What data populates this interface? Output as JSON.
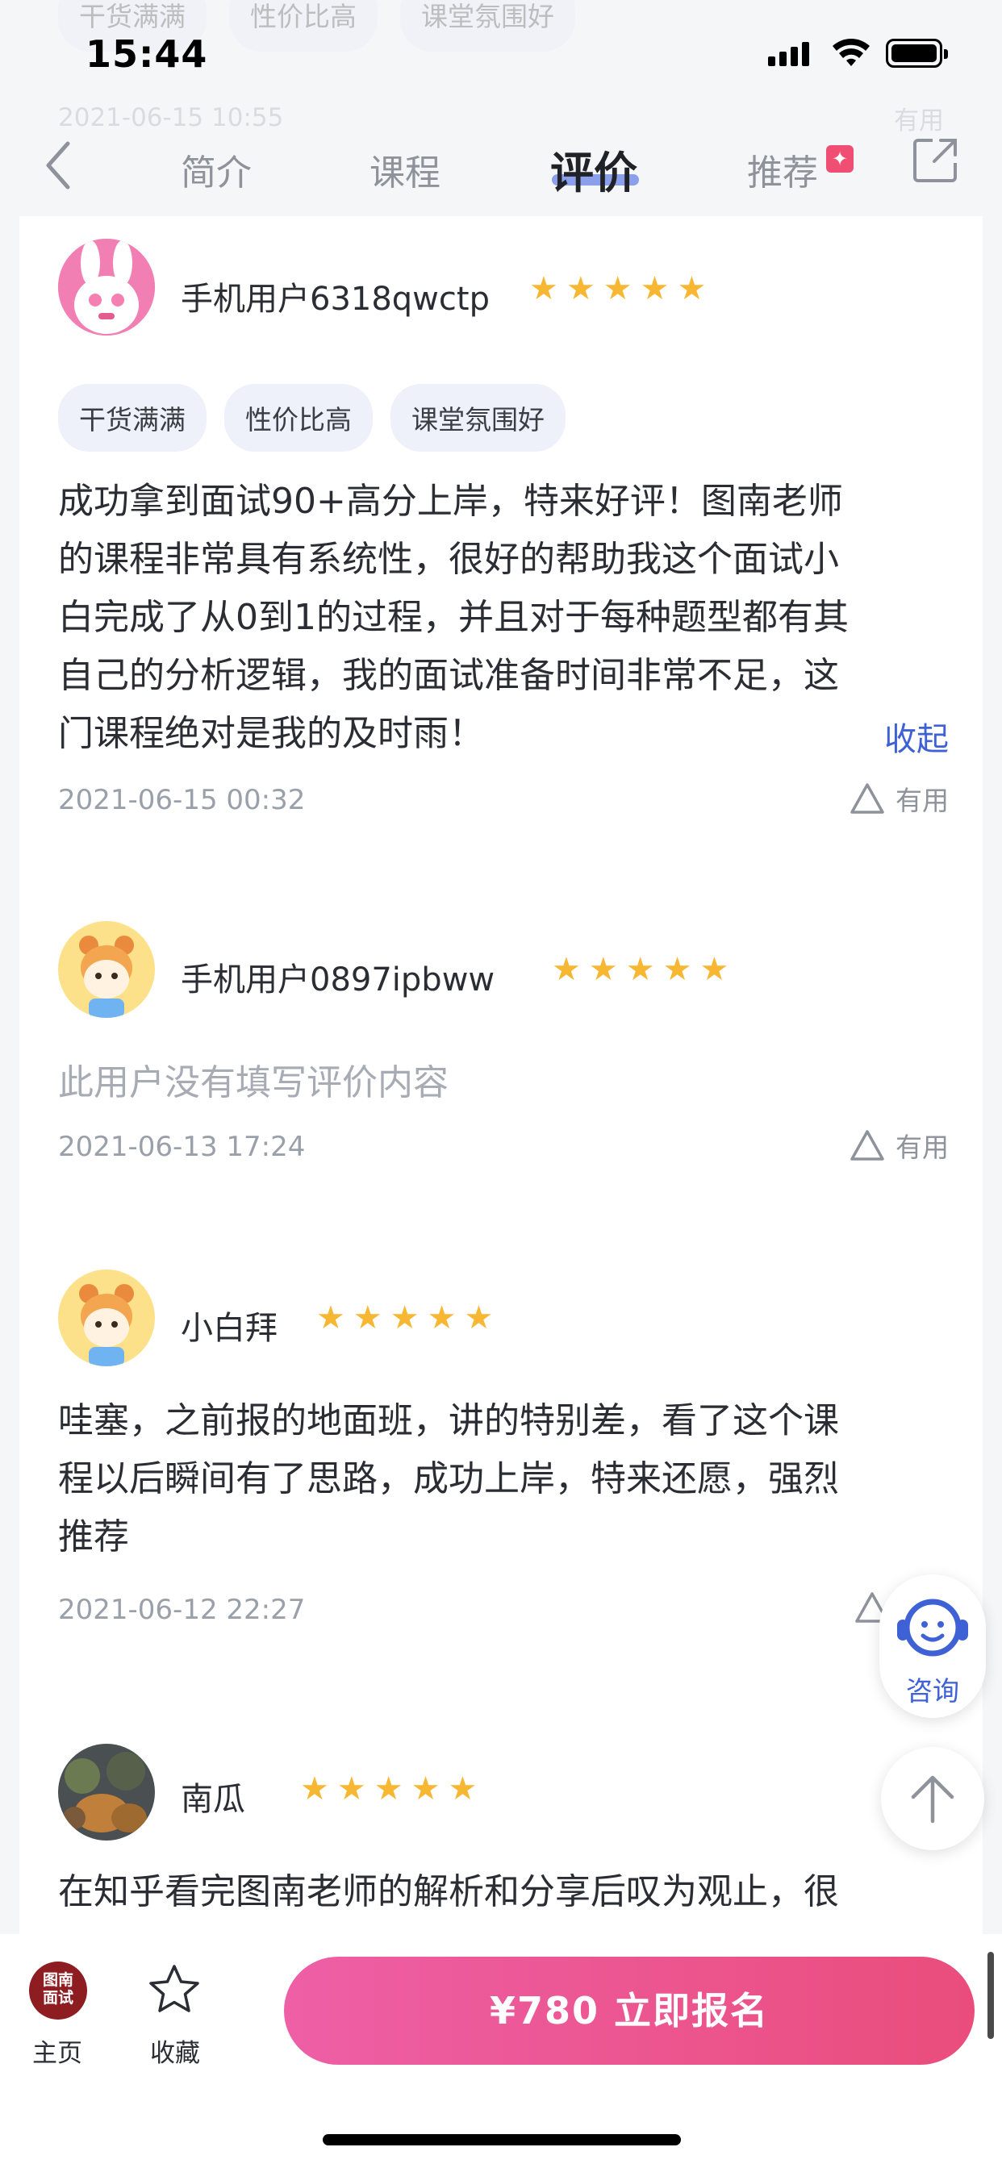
{
  "status_bar": {
    "time": "15:44"
  },
  "ghost": {
    "tags": [
      "干货满满",
      "性价比高",
      "课堂氛围好"
    ],
    "date": "2021-06-15 10:55",
    "useful": "有用"
  },
  "nav": {
    "tabs": [
      {
        "label": "简介",
        "active": false
      },
      {
        "label": "课程",
        "active": false
      },
      {
        "label": "评价",
        "active": true
      },
      {
        "label": "推荐",
        "active": false
      }
    ],
    "badge": "✦"
  },
  "reviews": [
    {
      "user": "手机用户6318qwctp",
      "rating": 5,
      "tags": [
        "干货满满",
        "性价比高",
        "课堂氛围好"
      ],
      "content_lines": [
        "成功拿到面试90+高分上岸，特来好评！图南老师",
        "的课程非常具有系统性，很好的帮助我这个面试小",
        "白完成了从0到1的过程，并且对于每种题型都有其",
        "自己的分析逻辑，我的面试准备时间非常不足，这",
        "门课程绝对是我的及时雨！"
      ],
      "collapse": "收起",
      "date": "2021-06-15 00:32",
      "useful": "有用"
    },
    {
      "user": "手机用户0897ipbww",
      "rating": 5,
      "empty_text": "此用户没有填写评价内容",
      "date": "2021-06-13 17:24",
      "useful": "有用"
    },
    {
      "user": "小白拜",
      "rating": 5,
      "content_lines": [
        "哇塞，之前报的地面班，讲的特别差，看了这个课",
        "程以后瞬间有了思路，成功上岸，特来还愿，强烈",
        "推荐"
      ],
      "date": "2021-06-12 22:27"
    },
    {
      "user": "南瓜",
      "rating": 5,
      "content_lines": [
        "在知乎看完图南老师的解析和分享后叹为观止，很"
      ]
    }
  ],
  "float": {
    "consult": "咨询"
  },
  "bottom": {
    "logo_line1": "图南",
    "logo_line2": "面试",
    "home": "主页",
    "favorite": "收藏",
    "buy": "¥780  立即报名"
  },
  "colors": {
    "accent_blue": "#3f61d6",
    "star": "#f7b733",
    "buy_gradient_start": "#ee5fa6",
    "buy_gradient_end": "#ea4d7c",
    "logo": "#8e1d22"
  }
}
